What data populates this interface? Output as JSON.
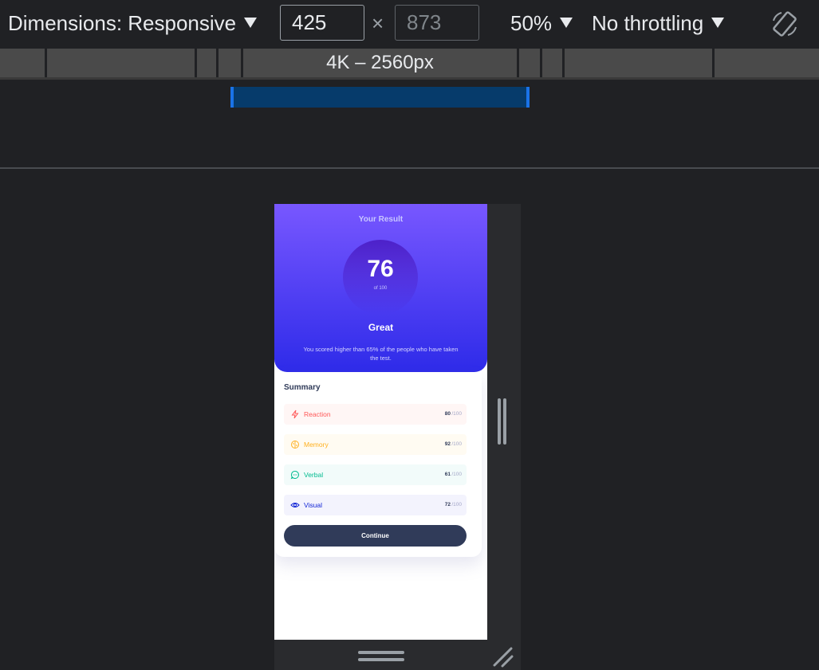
{
  "toolbar": {
    "dimensions_label": "Dimensions: Responsive",
    "width_value": "425",
    "height_value": "873",
    "times": "×",
    "zoom": "50%",
    "throttling": "No throttling"
  },
  "breakpoints": {
    "active_label": "4K – 2560px"
  },
  "result": {
    "title": "Your Result",
    "score": "76",
    "of": "of 100",
    "rating": "Great",
    "description": "You scored higher than 65% of the people who have taken the test."
  },
  "summary": {
    "title": "Summary",
    "items": [
      {
        "label": "Reaction",
        "value": "80",
        "max": " /100",
        "color": "#ff5757",
        "bg": "#fff6f5",
        "icon": "bolt-icon"
      },
      {
        "label": "Memory",
        "value": "92",
        "max": " /100",
        "color": "#ffb01f",
        "bg": "#fffbf2",
        "icon": "brain-icon"
      },
      {
        "label": "Verbal",
        "value": "61",
        "max": " /100",
        "color": "#00bb8f",
        "bg": "#f2fbfa",
        "icon": "chat-icon"
      },
      {
        "label": "Visual",
        "value": "72",
        "max": " /100",
        "color": "#1125d6",
        "bg": "#f3f3fd",
        "icon": "eye-icon"
      }
    ],
    "continue_label": "Continue"
  }
}
